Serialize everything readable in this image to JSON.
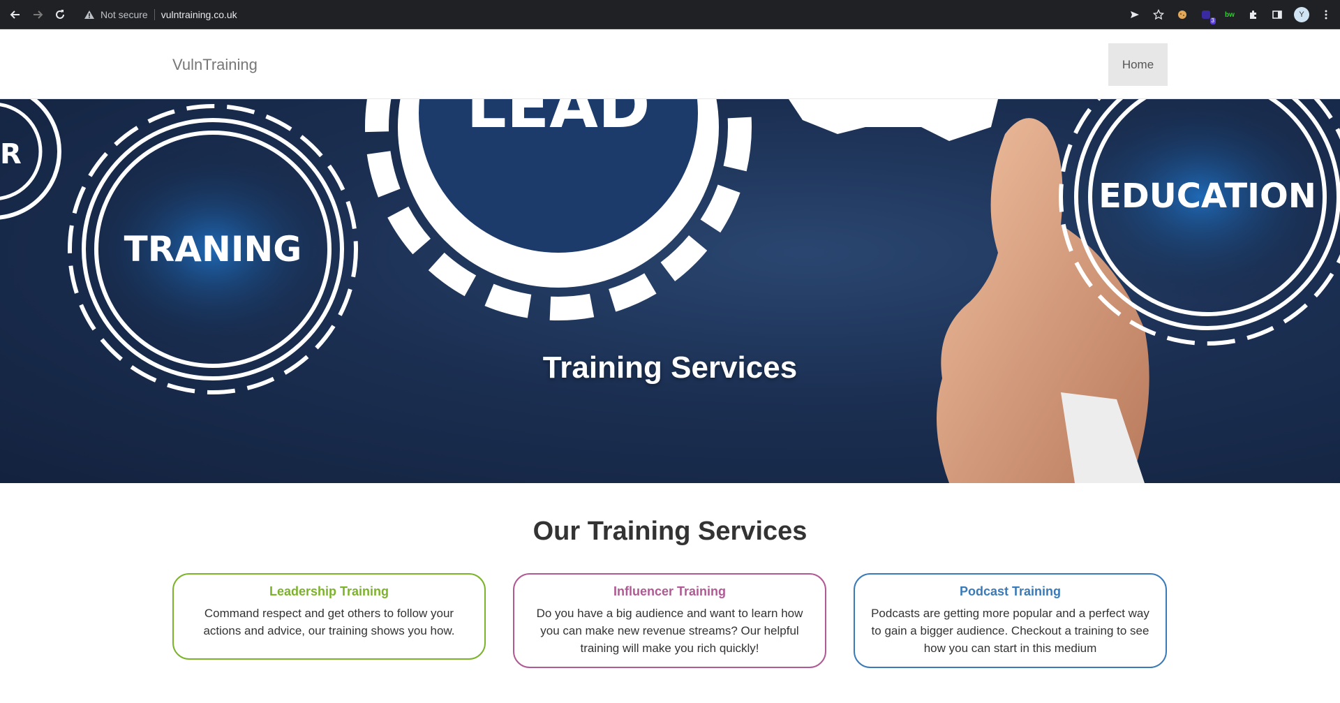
{
  "browser": {
    "security_label": "Not secure",
    "url": "vulntraining.co.uk",
    "extension_badge": "3",
    "extension_bw": "bw",
    "avatar_initial": "Y"
  },
  "site": {
    "brand": "VulnTraining",
    "nav": {
      "home_label": "Home"
    }
  },
  "hero": {
    "title": "Training Services",
    "gear_labels": [
      "TRANING",
      "LEAD",
      "EDUCATION",
      "R"
    ]
  },
  "services": {
    "heading": "Our Training Services",
    "cards": [
      {
        "title": "Leadership Training",
        "text": "Command respect and get others to follow your actions and advice, our training shows you how.",
        "color": "#7cb32a"
      },
      {
        "title": "Influencer Training",
        "text": "Do you have a big audience and want to learn how you can make new revenue streams? Our helpful training will make you rich quickly!",
        "color": "#b05a94"
      },
      {
        "title": "Podcast Training",
        "text": "Podcasts are getting more popular and a perfect way to gain a bigger audience. Checkout a training to see how you can start in this medium",
        "color": "#3a7ab8"
      }
    ]
  }
}
